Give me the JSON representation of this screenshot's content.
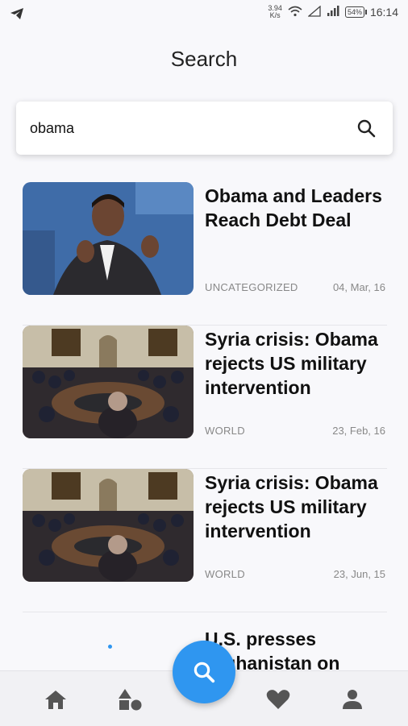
{
  "status_bar": {
    "network_speed": "3.94",
    "network_speed_unit": "K/s",
    "battery": "54%",
    "time": "16:14"
  },
  "page": {
    "title": "Search"
  },
  "search": {
    "value": "obama",
    "placeholder": ""
  },
  "results": [
    {
      "title": "Obama and Leaders Reach Debt Deal",
      "category": "UNCATEGORIZED",
      "date": "04, Mar, 16"
    },
    {
      "title": "Syria crisis: Obama rejects US military intervention",
      "category": "WORLD",
      "date": "23, Feb, 16"
    },
    {
      "title": "Syria crisis: Obama rejects US military intervention",
      "category": "WORLD",
      "date": "23, Jun, 15"
    },
    {
      "title": "U.S. presses Afghanistan on militants"
    }
  ],
  "bottom_nav": {
    "tabs": [
      "home-icon",
      "categories-icon",
      "search-icon",
      "heart-icon",
      "profile-icon"
    ],
    "active": "search-icon",
    "accent": "#2f96f0"
  }
}
